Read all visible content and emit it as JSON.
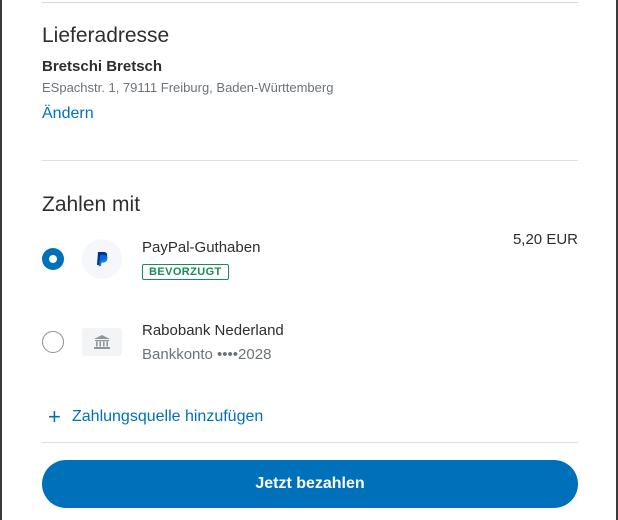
{
  "shipping": {
    "title": "Lieferadresse",
    "name": "Bretschi Bretsch",
    "address": "ESpachstr. 1, 79111 Freiburg, Baden-Württemberg",
    "change_link": "Ändern"
  },
  "payment": {
    "title": "Zahlen mit",
    "methods": [
      {
        "name": "PayPal-Guthaben",
        "badge": "BEVORZUGT",
        "amount": "5,20 EUR",
        "selected": true,
        "icon": "paypal-logo-icon"
      },
      {
        "name": "Rabobank Nederland",
        "detail": "Bankkonto ••••2028",
        "selected": false,
        "icon": "bank-icon"
      }
    ],
    "add_source": "Zahlungsquelle hinzufügen"
  },
  "pay_button": "Jetzt bezahlen",
  "colors": {
    "accent": "#0070ba",
    "badge": "#1a8a5a",
    "text": "#2c2e2f",
    "muted": "#6c7378"
  }
}
